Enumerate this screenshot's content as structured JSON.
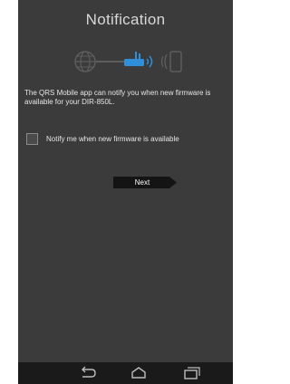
{
  "screen": {
    "title": "Notification",
    "message": "The QRS Mobile app can notify you when new firmware is available for your DIR-850L.",
    "checkbox_label": "Notify me when new firmware is available",
    "checkbox_checked": false,
    "next_label": "Next"
  },
  "diagram": {
    "icons": [
      "globe-icon",
      "router-icon",
      "wifi-signal-icon",
      "mobile-phone-icon"
    ],
    "active_color": "#2f8fd8",
    "inactive_color": "#5d5d5d"
  },
  "navbar": {
    "icons": [
      "back-icon",
      "home-icon",
      "recent-apps-icon"
    ]
  }
}
